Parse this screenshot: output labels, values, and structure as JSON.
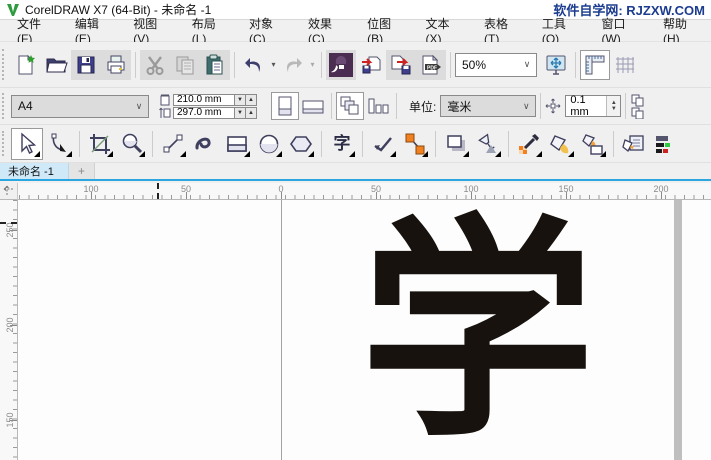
{
  "title_bar": {
    "app_title": "CorelDRAW X7 (64-Bit) - 未命名 -1",
    "promo": "软件自学网: RJZXW.COM"
  },
  "menu_bar": {
    "items": [
      "文件(F)",
      "编辑(E)",
      "视图(V)",
      "布局(L)",
      "对象(C)",
      "效果(C)",
      "位图(B)",
      "文本(X)",
      "表格(T)",
      "工具(O)",
      "窗口(W)",
      "帮助(H)"
    ]
  },
  "standard_toolbar": {
    "zoom_value": "50%",
    "pdf_label": "PDF",
    "icons": [
      "new-document",
      "open-folder",
      "save",
      "print",
      "cut",
      "copy",
      "paste",
      "undo",
      "redo",
      "corel-connect-search",
      "import",
      "export",
      "publish-pdf",
      "zoom-level-combo",
      "fullscreen-preview",
      "show-rulers",
      "show-grid"
    ]
  },
  "property_bar": {
    "page_size_preset": "A4",
    "page_width": "210.0 mm",
    "page_height": "297.0 mm",
    "units_label": "单位:",
    "units_value": "毫米",
    "nudge_value": "0.1 mm",
    "icons": [
      "portrait-orientation",
      "landscape-orientation",
      "all-pages",
      "current-page",
      "nudge-distance",
      "duplicate-distance"
    ]
  },
  "toolbox": {
    "text_tool_glyph": "字",
    "icons": [
      "pick-tool",
      "shape-tool",
      "crop-tool",
      "zoom-tool",
      "freehand-tool",
      "artistic-media-tool",
      "rectangle-tool",
      "ellipse-tool",
      "polygon-tool",
      "text-tool",
      "dimension-tool",
      "connector-tool",
      "drop-shadow-tool",
      "transparency-tool",
      "color-eyedropper-tool",
      "smart-fill-tool",
      "interactive-fill-tool",
      "edit-fill-dialog",
      "outline-pen"
    ]
  },
  "tab_bar": {
    "active_tab": "未命名 -1",
    "new_tab": "+"
  },
  "rulers": {
    "horizontal": [
      "100",
      "50",
      "0",
      "50",
      "100",
      "150",
      "200"
    ],
    "vertical": [
      "250",
      "200",
      "150"
    ]
  },
  "canvas": {
    "text_object": "学"
  },
  "colors": {
    "tab_underline": "#2BA6E0",
    "promo_text": "#1b3c8f",
    "connect_purple": "#4b2d52",
    "arrow_red": "#cc2222",
    "node_orange": "#f08020",
    "icon_navy": "#3f3f5e"
  }
}
